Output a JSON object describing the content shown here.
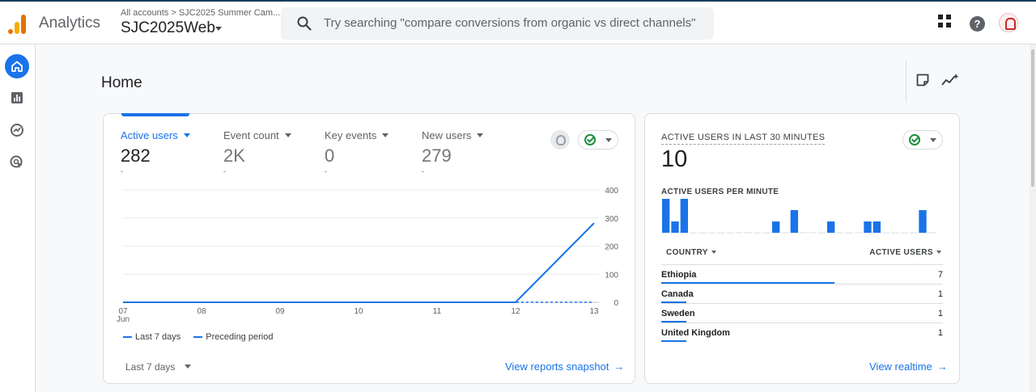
{
  "header": {
    "app_name": "Analytics",
    "breadcrumb": "All accounts > SJC2025 Summer Cam...",
    "property": "SJC2025Web",
    "search_placeholder": "Try searching \"compare conversions from organic vs direct channels\""
  },
  "page": {
    "title": "Home"
  },
  "metrics": [
    {
      "label": "Active users",
      "value": "282",
      "sub": "-"
    },
    {
      "label": "Event count",
      "value": "2K",
      "sub": "-"
    },
    {
      "label": "Key events",
      "value": "0",
      "sub": "-"
    },
    {
      "label": "New users",
      "value": "279",
      "sub": "-"
    }
  ],
  "chart_data": {
    "type": "line",
    "x": [
      "07",
      "08",
      "09",
      "10",
      "11",
      "12",
      "13"
    ],
    "x_sublabel": "Jun",
    "ylim": [
      0,
      400
    ],
    "yticks": [
      0,
      100,
      200,
      300,
      400
    ],
    "series": [
      {
        "name": "Last 7 days",
        "values": [
          0,
          0,
          0,
          0,
          0,
          0,
          282
        ]
      },
      {
        "name": "Preceding period",
        "values": [
          0,
          0,
          0,
          0,
          0,
          0,
          0
        ]
      }
    ],
    "legend_placement": "bottom-left"
  },
  "footer": {
    "range": "Last 7 days",
    "snapshot_link": "View reports snapshot"
  },
  "realtime": {
    "title": "ACTIVE USERS IN LAST 30 MINUTES",
    "count": "10",
    "per_minute_label": "ACTIVE USERS PER MINUTE",
    "per_minute": [
      3,
      1,
      3,
      0,
      0,
      0,
      0,
      0,
      0,
      0,
      0,
      0,
      1,
      0,
      2,
      0,
      0,
      0,
      1,
      0,
      0,
      0,
      1,
      1,
      0,
      0,
      0,
      0,
      2,
      0
    ],
    "col_country": "COUNTRY",
    "col_users": "ACTIVE USERS",
    "rows": [
      {
        "country": "Ethiopia",
        "users": "7",
        "share": 0.7
      },
      {
        "country": "Canada",
        "users": "1",
        "share": 0.1
      },
      {
        "country": "Sweden",
        "users": "1",
        "share": 0.1
      },
      {
        "country": "United Kingdom",
        "users": "1",
        "share": 0.1
      }
    ],
    "link": "View realtime"
  },
  "colors": {
    "accent": "#1a73e8",
    "ok": "#1e8e3e"
  }
}
